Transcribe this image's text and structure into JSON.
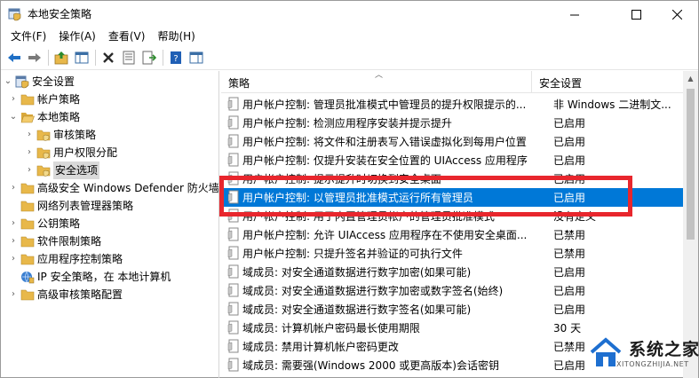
{
  "window": {
    "title": "本地安全策略",
    "controls": [
      "minimize-icon",
      "maximize-icon",
      "close-icon"
    ]
  },
  "menu": {
    "file": "文件(F)",
    "action": "操作(A)",
    "view": "查看(V)",
    "help": "帮助(H)"
  },
  "toolbar": {
    "buttons": [
      "back-arrow-icon",
      "forward-arrow-icon",
      "up-folder-icon",
      "show-tree-icon",
      "delete-icon",
      "properties-icon",
      "export-icon",
      "help-icon",
      "console-icon"
    ]
  },
  "tree": {
    "items": [
      {
        "label": "安全设置",
        "level": 0,
        "expanded": true
      },
      {
        "label": "帐户策略",
        "level": 1,
        "expanded": false
      },
      {
        "label": "本地策略",
        "level": 1,
        "expanded": true
      },
      {
        "label": "审核策略",
        "level": 2,
        "expanded": false
      },
      {
        "label": "用户权限分配",
        "level": 2,
        "expanded": false
      },
      {
        "label": "安全选项",
        "level": 2,
        "selected": true
      },
      {
        "label": "高级安全 Windows Defender 防火墙",
        "level": 1,
        "expanded": false
      },
      {
        "label": "网络列表管理器策略",
        "level": 1
      },
      {
        "label": "公钥策略",
        "level": 1,
        "expanded": false
      },
      {
        "label": "软件限制策略",
        "level": 1,
        "expanded": false
      },
      {
        "label": "应用程序控制策略",
        "level": 1,
        "expanded": false
      },
      {
        "label": "IP 安全策略，在 本地计算机",
        "level": 1
      },
      {
        "label": "高级审核策略配置",
        "level": 1,
        "expanded": false
      }
    ]
  },
  "list": {
    "columns": {
      "policy": "策略",
      "setting": "安全设置"
    },
    "rows": [
      {
        "policy": "用户帐户控制: 管理员批准模式中管理员的提升权限提示的...",
        "setting": "非 Windows 二进制文..."
      },
      {
        "policy": "用户帐户控制: 检测应用程序安装并提示提升",
        "setting": "已启用"
      },
      {
        "policy": "用户帐户控制: 将文件和注册表写入错误虚拟化到每用户位置",
        "setting": "已启用"
      },
      {
        "policy": "用户帐户控制: 仅提升安装在安全位置的 UIAccess 应用程序",
        "setting": "已启用"
      },
      {
        "policy": "用户帐户控制: 提示提升时切换到安全桌面",
        "setting": "已启用"
      },
      {
        "policy": "用户帐户控制: 以管理员批准模式运行所有管理员",
        "setting": "已启用",
        "selected": true
      },
      {
        "policy": "用户帐户控制: 用于内置管理员帐户的管理员批准模式",
        "setting": "没有定义"
      },
      {
        "policy": "用户帐户控制: 允许 UIAccess 应用程序在不使用安全桌面...",
        "setting": "已禁用"
      },
      {
        "policy": "用户帐户控制: 只提升签名并验证的可执行文件",
        "setting": "已禁用"
      },
      {
        "policy": "域成员: 对安全通道数据进行数字加密(如果可能)",
        "setting": "已启用"
      },
      {
        "policy": "域成员: 对安全通道数据进行数字加密或数字签名(始终)",
        "setting": "已启用"
      },
      {
        "policy": "域成员: 对安全通道数据进行数字签名(如果可能)",
        "setting": "已启用"
      },
      {
        "policy": "域成员: 计算机帐户密码最长使用期限",
        "setting": "30 天"
      },
      {
        "policy": "域成员: 禁用计算机帐户密码更改",
        "setting": "已禁用"
      },
      {
        "policy": "域成员: 需要强(Windows 2000 或更高版本)会话密钥",
        "setting": "已启用"
      }
    ]
  },
  "watermark": {
    "title": "系统之家",
    "url": "XITONGZHIJIA.NET"
  },
  "colors": {
    "selection": "#0078d7",
    "highlight_box": "#e8262d",
    "folder": "#e8b84a"
  }
}
